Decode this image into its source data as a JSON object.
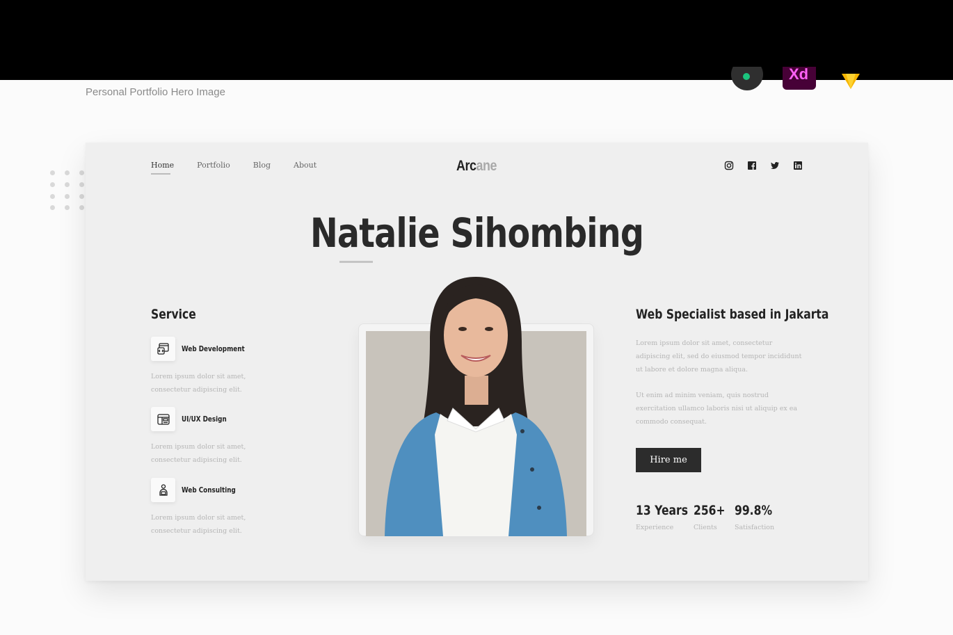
{
  "page_caption": "Personal Portfolio Hero Image",
  "tool_icons": [
    "figma-icon",
    "adobe-xd-icon",
    "sketch-icon"
  ],
  "tool_xd_label": "Xd",
  "colors": {
    "topbar": "#000000",
    "mockup_bg": "#efefef",
    "button_bg": "#2c2c2c",
    "muted_text": "#b5b5b5",
    "figma_green": "#1bc47d",
    "xd_purple": "#470137",
    "sketch_orange": "#f7b500"
  },
  "nav": {
    "links": [
      "Home",
      "Portfolio",
      "Blog",
      "About"
    ],
    "active": "Home"
  },
  "logo": {
    "dark": "Arc",
    "light": "ane"
  },
  "socials": [
    "instagram-icon",
    "facebook-icon",
    "twitter-icon",
    "linkedin-icon"
  ],
  "hero": {
    "title": "Natalie Sihombing"
  },
  "services": {
    "heading": "Service",
    "items": [
      {
        "name": "Web Development",
        "icon": "web-development-icon",
        "desc": "Lorem ipsum dolor sit amet, consectetur adipiscing elit."
      },
      {
        "name": "UI/UX Design",
        "icon": "ui-ux-design-icon",
        "desc": "Lorem ipsum dolor sit amet, consectetur adipiscing elit."
      },
      {
        "name": "Web Consulting",
        "icon": "web-consulting-icon",
        "desc": "Lorem ipsum dolor sit amet, consectetur adipiscing elit."
      }
    ]
  },
  "about": {
    "heading": "Web Specialist based in Jakarta",
    "para1": "Lorem ipsum dolor sit amet, consectetur adipiscing elit, sed do eiusmod tempor incididunt ut labore et dolore magna aliqua.",
    "para2": "Ut enim ad minim veniam, quis nostrud exercitation ullamco laboris nisi ut aliquip ex ea commodo consequat.",
    "button": "Hire me"
  },
  "stats": [
    {
      "value": "13 Years",
      "label": "Experience"
    },
    {
      "value": "256+",
      "label": "Clients"
    },
    {
      "value": "99.8%",
      "label": "Satisfaction"
    }
  ]
}
